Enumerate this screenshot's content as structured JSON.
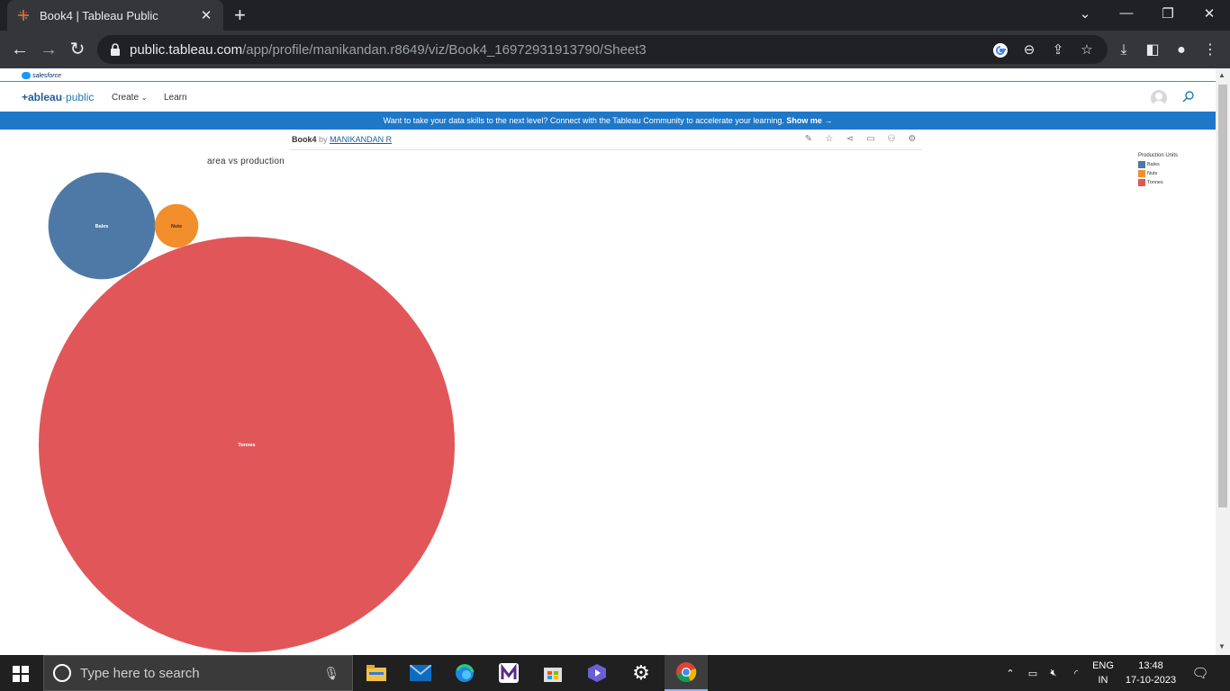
{
  "browser": {
    "tab_title": "Book4 | Tableau Public",
    "new_tab": "+",
    "url_host": "public.tableau.com",
    "url_path": "/app/profile/manikandan.r8649/viz/Book4_16972931913790/Sheet3"
  },
  "salesforce": {
    "logo_text": "salesforce"
  },
  "header": {
    "logo_main": "+ableau",
    "logo_sub": "public",
    "nav_create": "Create",
    "nav_learn": "Learn"
  },
  "banner": {
    "text": "Want to take your data skills to the next level? Connect with the Tableau Community to accelerate your learning.",
    "cta": "Show me →"
  },
  "viz": {
    "book": "Book4",
    "by": "by",
    "author": "MANIKANDAN R"
  },
  "sheet_title": "area vs production",
  "legend": {
    "title": "Production Units",
    "items": [
      {
        "label": "Bales",
        "color": "#4e79a7"
      },
      {
        "label": "Nuts",
        "color": "#f28e2b"
      },
      {
        "label": "Tonnes",
        "color": "#e15759"
      }
    ]
  },
  "chart_data": {
    "type": "bubble",
    "series": [
      {
        "name": "Bales",
        "relative_size": 0.066,
        "color": "#4e79a7"
      },
      {
        "name": "Nuts",
        "relative_size": 0.011,
        "color": "#f28e2b"
      },
      {
        "name": "Tonnes",
        "relative_size": 1.0,
        "color": "#e15759"
      }
    ]
  },
  "taskbar": {
    "search_placeholder": "Type here to search",
    "lang_top": "ENG",
    "lang_bottom": "IN",
    "time": "13:48",
    "date": "17-10-2023"
  }
}
